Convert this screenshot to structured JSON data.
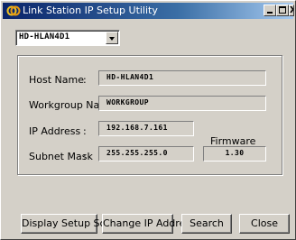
{
  "window": {
    "title": "Link Station IP Setup Utility",
    "controls": {
      "minimize": "_",
      "maximize": "□",
      "close": "X"
    }
  },
  "device_select": {
    "value": "HD-HLAN4D1"
  },
  "form": {
    "host_name": {
      "label": "Host Name",
      "value": "HD-HLAN4D1"
    },
    "workgroup_name": {
      "label": "Workgroup Name",
      "value": "WORKGROUP"
    },
    "ip_address": {
      "label": "IP Address",
      "value": "192.168.7.161"
    },
    "subnet_mask": {
      "label": "Subnet Mask",
      "value": "255.255.255.0"
    },
    "firmware": {
      "label": "Firmware",
      "value": "1.30"
    },
    "colon": ":"
  },
  "buttons": {
    "display_setup_screen": "Display Setup Screen",
    "change_ip_address": "Change IP Address",
    "search": "Search",
    "close": "Close"
  },
  "colors": {
    "titlebar_start": "#0a246a",
    "titlebar_end": "#a6caf0",
    "face": "#d4d0c8"
  },
  "icons": {
    "app": "link-station-icon",
    "dropdown": "chevron-down-icon"
  }
}
